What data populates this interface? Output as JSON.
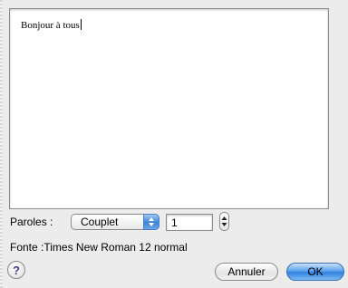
{
  "editor": {
    "text": "Bonjour à tous"
  },
  "lyrics": {
    "label": "Paroles :",
    "section_selected": "Couplet",
    "number_value": "1"
  },
  "font_info": "Fonte :Times New Roman 12 normal",
  "buttons": {
    "help": "?",
    "cancel": "Annuler",
    "ok": "OK"
  },
  "icons": {
    "popup": "up-down-arrows-icon",
    "stepper": "stepper-arrows-icon",
    "help": "help-icon"
  },
  "colors": {
    "accent": "#3b84d6",
    "window_bg": "#ececec"
  }
}
